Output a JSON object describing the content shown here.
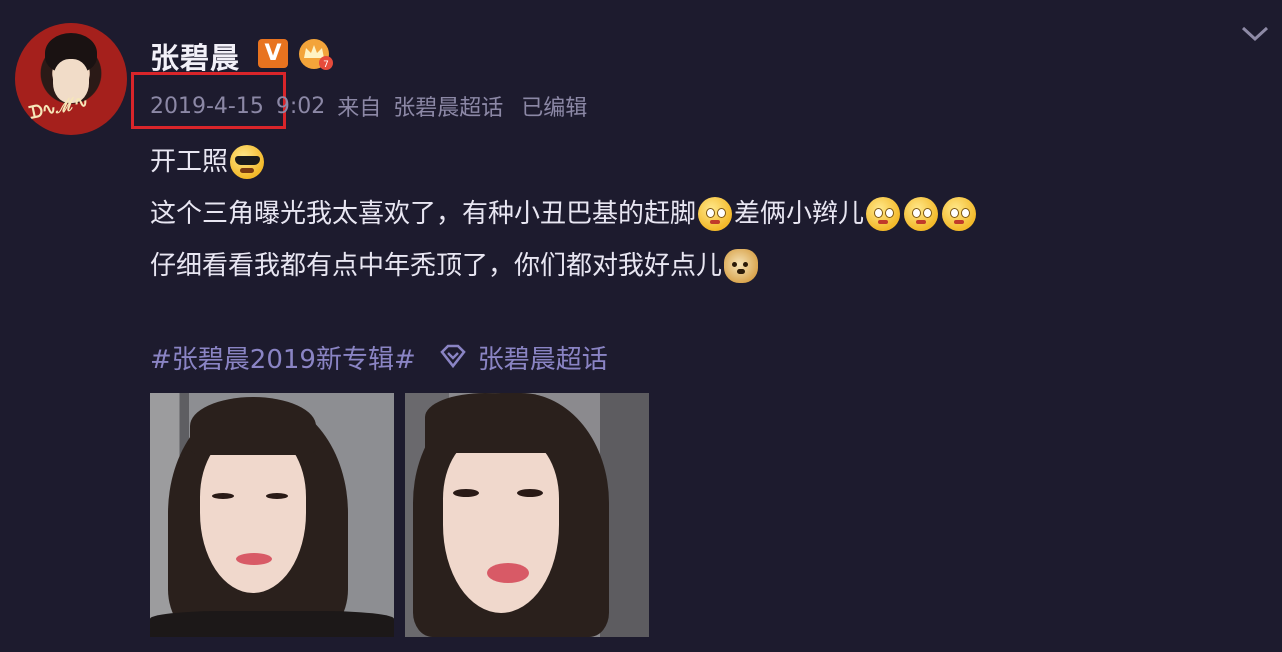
{
  "post": {
    "username": "张碧晨",
    "vip_badge": "V",
    "date": "2019-4-15",
    "time": "9:02",
    "via": "来自",
    "source": "张碧晨超话",
    "edited": "已编辑",
    "lines": {
      "l1": "开工照",
      "l2a": "这个三角曝光我太喜欢了，有种小丑巴基的赶脚",
      "l2b": "差俩小辫儿",
      "l3": "仔细看看我都有点中年秃顶了，你们都对我好点儿"
    },
    "emojis": {
      "l1": "cool-sunglasses-icon",
      "l2": [
        "drool-emoji-icon",
        "drool-emoji-icon",
        "drool-emoji-icon",
        "drool-emoji-icon"
      ],
      "l3": "doge-emoji-icon"
    },
    "topic": "#张碧晨2019新专辑#",
    "supertopic": "张碧晨超话",
    "photos": [
      "photo-1",
      "photo-2"
    ]
  },
  "colors": {
    "background": "#1d1b2e",
    "meta_text": "#8c88a6",
    "topic_link": "#8a84c4",
    "highlight_box": "#d9252a",
    "vip_badge": "#e8731f"
  }
}
